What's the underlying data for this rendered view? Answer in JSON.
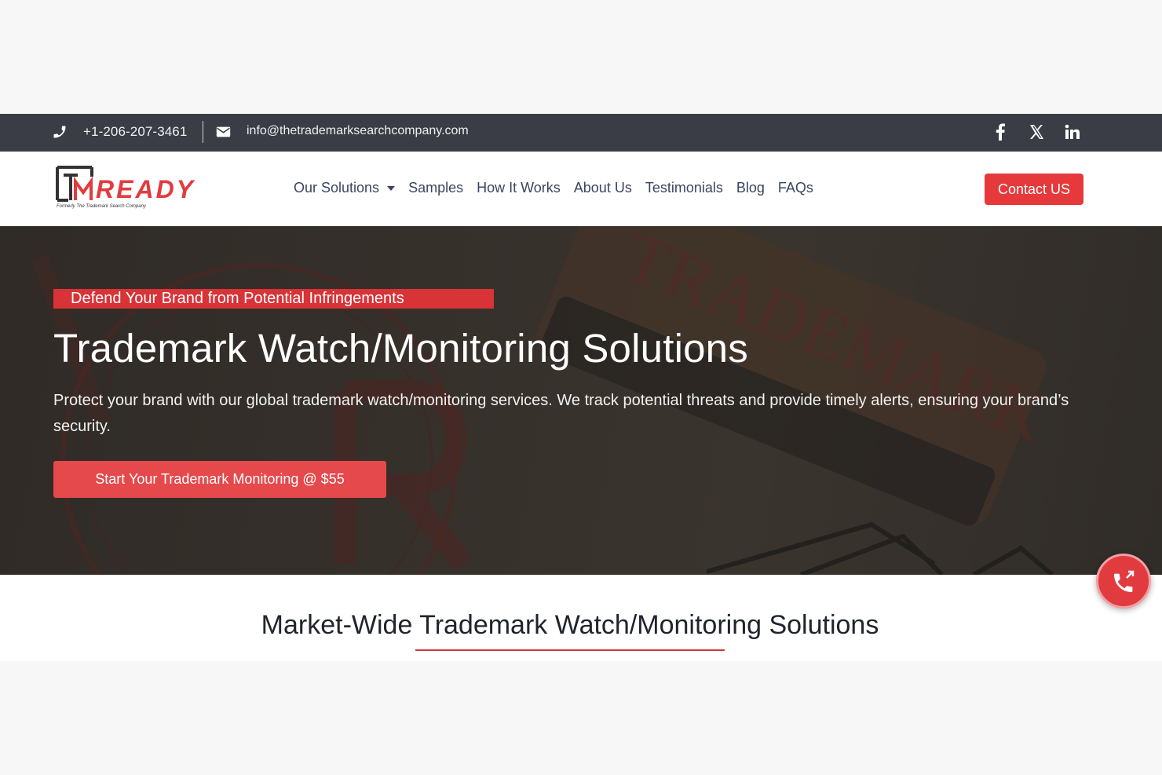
{
  "topbar": {
    "phone_icon": "phone-icon",
    "phone": "+1-206-207-3461",
    "mail_icon": "envelope-icon",
    "email": "info@thetrademarksearchcompany.com",
    "social": [
      "facebook-icon",
      "x-icon",
      "linkedin-icon"
    ]
  },
  "logo": {
    "mark": "TM",
    "word": "READY",
    "tagline": "Formerly The Trademark Search Company"
  },
  "nav": {
    "items": [
      {
        "label": "Our Solutions",
        "dropdown": true
      },
      {
        "label": "Samples"
      },
      {
        "label": "How It Works"
      },
      {
        "label": "About Us"
      },
      {
        "label": "Testimonials"
      },
      {
        "label": "Blog"
      },
      {
        "label": "FAQs"
      }
    ],
    "contact_label": "Contact US"
  },
  "hero": {
    "tag": "Defend Your Brand from Potential Infringements",
    "title": "Trademark Watch/Monitoring Solutions",
    "description": "Protect your brand with our global trademark watch/monitoring services. We track potential threats and provide timely alerts, ensuring your brand’s security.",
    "cta_label": "Start Your Trademark Monitoring @ $55"
  },
  "section": {
    "title": "Market-Wide Trademark Watch/Monitoring Solutions"
  },
  "colors": {
    "accent": "#e23b3f",
    "topbar": "#3a3d45",
    "nav_text": "#3a4560"
  }
}
